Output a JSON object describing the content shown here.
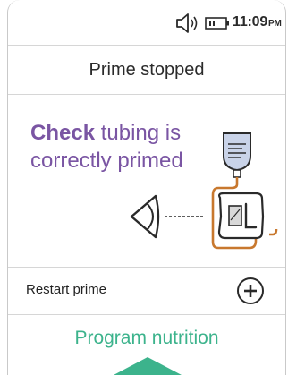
{
  "status": {
    "time": "11:09",
    "time_suffix": "PM",
    "speaker_icon": "speaker-icon",
    "battery_icon": "battery-icon"
  },
  "header": {
    "title": "Prime stopped"
  },
  "message": {
    "emphasis": "Check",
    "rest": " tubing is correctly primed"
  },
  "illustration": {
    "icons": [
      "eye-icon",
      "iv-bag-icon",
      "pump-cassette-icon"
    ]
  },
  "actions": {
    "restart_label": "Restart prime",
    "restart_icon": "plus-circle-icon",
    "program_label": "Program nutrition"
  },
  "colors": {
    "accent_purple": "#7a55a3",
    "accent_green": "#3cb38c",
    "tubing_orange": "#c8782e",
    "bag_fill": "#c9d3e8"
  }
}
